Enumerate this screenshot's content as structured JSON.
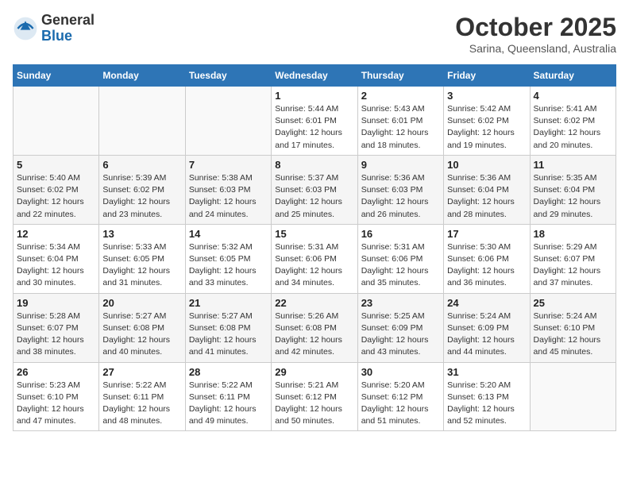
{
  "header": {
    "logo_general": "General",
    "logo_blue": "Blue",
    "month_title": "October 2025",
    "location": "Sarina, Queensland, Australia"
  },
  "days_of_week": [
    "Sunday",
    "Monday",
    "Tuesday",
    "Wednesday",
    "Thursday",
    "Friday",
    "Saturday"
  ],
  "weeks": [
    [
      {
        "day": "",
        "info": ""
      },
      {
        "day": "",
        "info": ""
      },
      {
        "day": "",
        "info": ""
      },
      {
        "day": "1",
        "info": "Sunrise: 5:44 AM\nSunset: 6:01 PM\nDaylight: 12 hours\nand 17 minutes."
      },
      {
        "day": "2",
        "info": "Sunrise: 5:43 AM\nSunset: 6:01 PM\nDaylight: 12 hours\nand 18 minutes."
      },
      {
        "day": "3",
        "info": "Sunrise: 5:42 AM\nSunset: 6:02 PM\nDaylight: 12 hours\nand 19 minutes."
      },
      {
        "day": "4",
        "info": "Sunrise: 5:41 AM\nSunset: 6:02 PM\nDaylight: 12 hours\nand 20 minutes."
      }
    ],
    [
      {
        "day": "5",
        "info": "Sunrise: 5:40 AM\nSunset: 6:02 PM\nDaylight: 12 hours\nand 22 minutes."
      },
      {
        "day": "6",
        "info": "Sunrise: 5:39 AM\nSunset: 6:02 PM\nDaylight: 12 hours\nand 23 minutes."
      },
      {
        "day": "7",
        "info": "Sunrise: 5:38 AM\nSunset: 6:03 PM\nDaylight: 12 hours\nand 24 minutes."
      },
      {
        "day": "8",
        "info": "Sunrise: 5:37 AM\nSunset: 6:03 PM\nDaylight: 12 hours\nand 25 minutes."
      },
      {
        "day": "9",
        "info": "Sunrise: 5:36 AM\nSunset: 6:03 PM\nDaylight: 12 hours\nand 26 minutes."
      },
      {
        "day": "10",
        "info": "Sunrise: 5:36 AM\nSunset: 6:04 PM\nDaylight: 12 hours\nand 28 minutes."
      },
      {
        "day": "11",
        "info": "Sunrise: 5:35 AM\nSunset: 6:04 PM\nDaylight: 12 hours\nand 29 minutes."
      }
    ],
    [
      {
        "day": "12",
        "info": "Sunrise: 5:34 AM\nSunset: 6:04 PM\nDaylight: 12 hours\nand 30 minutes."
      },
      {
        "day": "13",
        "info": "Sunrise: 5:33 AM\nSunset: 6:05 PM\nDaylight: 12 hours\nand 31 minutes."
      },
      {
        "day": "14",
        "info": "Sunrise: 5:32 AM\nSunset: 6:05 PM\nDaylight: 12 hours\nand 33 minutes."
      },
      {
        "day": "15",
        "info": "Sunrise: 5:31 AM\nSunset: 6:06 PM\nDaylight: 12 hours\nand 34 minutes."
      },
      {
        "day": "16",
        "info": "Sunrise: 5:31 AM\nSunset: 6:06 PM\nDaylight: 12 hours\nand 35 minutes."
      },
      {
        "day": "17",
        "info": "Sunrise: 5:30 AM\nSunset: 6:06 PM\nDaylight: 12 hours\nand 36 minutes."
      },
      {
        "day": "18",
        "info": "Sunrise: 5:29 AM\nSunset: 6:07 PM\nDaylight: 12 hours\nand 37 minutes."
      }
    ],
    [
      {
        "day": "19",
        "info": "Sunrise: 5:28 AM\nSunset: 6:07 PM\nDaylight: 12 hours\nand 38 minutes."
      },
      {
        "day": "20",
        "info": "Sunrise: 5:27 AM\nSunset: 6:08 PM\nDaylight: 12 hours\nand 40 minutes."
      },
      {
        "day": "21",
        "info": "Sunrise: 5:27 AM\nSunset: 6:08 PM\nDaylight: 12 hours\nand 41 minutes."
      },
      {
        "day": "22",
        "info": "Sunrise: 5:26 AM\nSunset: 6:08 PM\nDaylight: 12 hours\nand 42 minutes."
      },
      {
        "day": "23",
        "info": "Sunrise: 5:25 AM\nSunset: 6:09 PM\nDaylight: 12 hours\nand 43 minutes."
      },
      {
        "day": "24",
        "info": "Sunrise: 5:24 AM\nSunset: 6:09 PM\nDaylight: 12 hours\nand 44 minutes."
      },
      {
        "day": "25",
        "info": "Sunrise: 5:24 AM\nSunset: 6:10 PM\nDaylight: 12 hours\nand 45 minutes."
      }
    ],
    [
      {
        "day": "26",
        "info": "Sunrise: 5:23 AM\nSunset: 6:10 PM\nDaylight: 12 hours\nand 47 minutes."
      },
      {
        "day": "27",
        "info": "Sunrise: 5:22 AM\nSunset: 6:11 PM\nDaylight: 12 hours\nand 48 minutes."
      },
      {
        "day": "28",
        "info": "Sunrise: 5:22 AM\nSunset: 6:11 PM\nDaylight: 12 hours\nand 49 minutes."
      },
      {
        "day": "29",
        "info": "Sunrise: 5:21 AM\nSunset: 6:12 PM\nDaylight: 12 hours\nand 50 minutes."
      },
      {
        "day": "30",
        "info": "Sunrise: 5:20 AM\nSunset: 6:12 PM\nDaylight: 12 hours\nand 51 minutes."
      },
      {
        "day": "31",
        "info": "Sunrise: 5:20 AM\nSunset: 6:13 PM\nDaylight: 12 hours\nand 52 minutes."
      },
      {
        "day": "",
        "info": ""
      }
    ]
  ]
}
